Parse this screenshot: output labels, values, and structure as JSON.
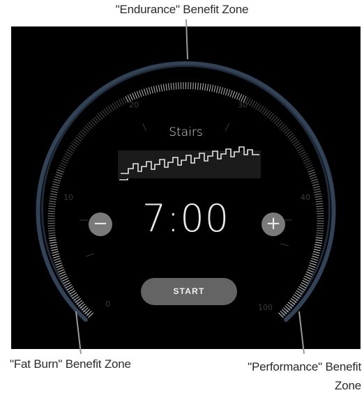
{
  "callouts": {
    "top": "\"Endurance\" Benefit Zone",
    "left": "\"Fat Burn\" Benefit Zone",
    "right_line1": "\"Performance\" Benefit",
    "right_line2": "Zone"
  },
  "workout": {
    "mode": "Stairs",
    "time": "7:00",
    "decrease_icon": "minus-icon",
    "increase_icon": "plus-icon",
    "start_label": "START"
  },
  "dial": {
    "scale_labels": [
      "0",
      "10",
      "20",
      "30",
      "40",
      "100"
    ]
  },
  "colors": {
    "panel_bg": "#000000",
    "ring": "#3b4f66",
    "button_gray": "#7a7a7a",
    "start_gray": "#646464"
  }
}
